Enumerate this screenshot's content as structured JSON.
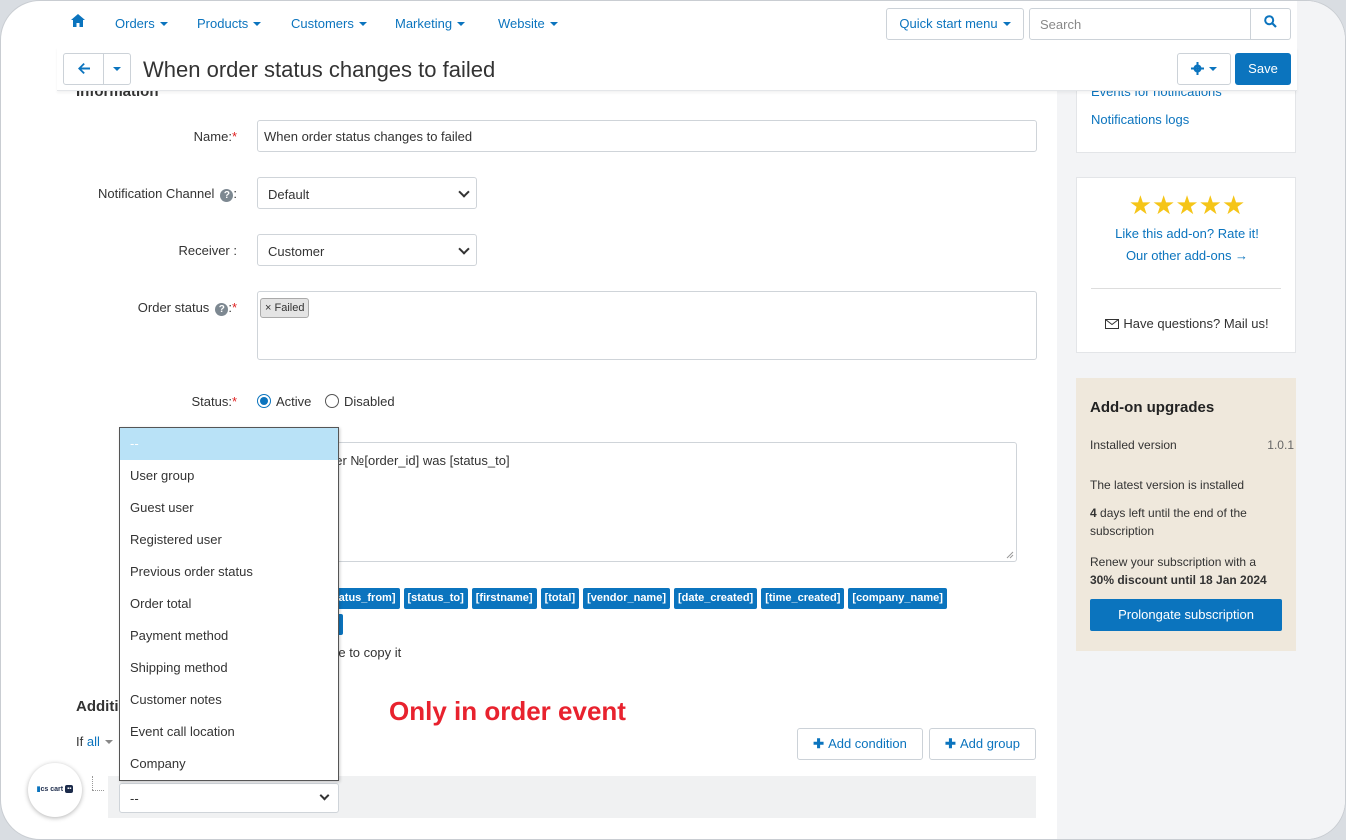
{
  "nav": {
    "items": [
      "Orders",
      "Products",
      "Customers",
      "Marketing",
      "Website"
    ],
    "quick_start": "Quick start menu",
    "search_placeholder": "Search"
  },
  "titlebar": {
    "title": "When order status changes to failed",
    "save_label": "Save"
  },
  "form": {
    "section_title": "Information",
    "name_label": "Name:",
    "name_value": "When order status changes to failed",
    "channel_label": "Notification Channel",
    "channel_value": "Default",
    "receiver_label": "Receiver :",
    "receiver_value": "Customer",
    "order_status_label": "Order status",
    "order_status_tag": "Failed",
    "status_label": "Status:",
    "status_active": "Active",
    "status_disabled": "Disabled",
    "message_visible": "der №[order_id] was [status_to]",
    "placeholders": [
      "tatus_from]",
      "[status_to]",
      "[firstname]",
      "[total]",
      "[vendor_name]",
      "[date_created]",
      "[time_created]",
      "[company_name]"
    ],
    "copy_hint": "able to copy it"
  },
  "conditions": {
    "section_title": "Additi",
    "if_text": "If",
    "all_text": "all",
    "add_condition": "Add condition",
    "add_group": "Add group",
    "condition_value": "--"
  },
  "dropdown": {
    "options": [
      "--",
      "User group",
      "Guest user",
      "Registered user",
      "Previous order status",
      "Order total",
      "Payment method",
      "Shipping method",
      "Customer notes",
      "Event call location",
      "Company"
    ],
    "selected_index": 0
  },
  "annotation": "Only in order event",
  "sidebar": {
    "events_link": "Events for notifications",
    "logs_link": "Notifications logs",
    "rate_text": "Like this add-on? Rate it!",
    "other_addons": "Our other add-ons →",
    "mail_text": "Have questions? Mail us!",
    "upgrades": {
      "title": "Add-on upgrades",
      "installed_label": "Installed version",
      "installed_version": "1.0.1",
      "latest_text": "The latest version is installed",
      "days_number": "4",
      "days_text": " days left until the end of the subscription",
      "renew_text": "Renew your subscription with a",
      "discount_text": "30% discount until 18 Jan 2024",
      "prolong_label": "Prolongate subscription"
    }
  },
  "logo": {
    "text": "cs cart"
  },
  "colors": {
    "accent": "#0b74be",
    "annotation": "#e8222e",
    "stars": "#f5c518"
  }
}
